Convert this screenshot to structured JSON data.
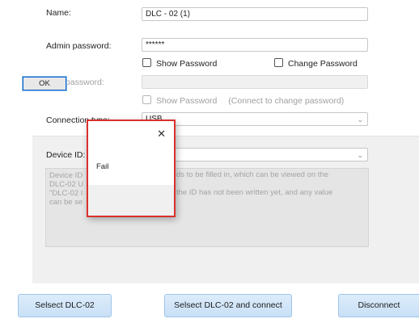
{
  "form": {
    "name_label": "Name:",
    "name_value": "DLC - 02 (1)",
    "admin_password_label": "Admin password:",
    "admin_password_value": "******",
    "show_password_1": "Show Password",
    "change_password": "Change Password",
    "new_password_label": "New password:",
    "new_password_value": "",
    "show_password_2": "Show Password",
    "change_hint": "(Connect to change password)",
    "connection_type_label": "Connection type:",
    "connection_type_value": "USB",
    "device_id_label": "Device ID:",
    "device_id_value": ""
  },
  "description": {
    "lines_left": [
      "Device ID",
      "DLC-02 U",
      "\"DLC-02 I",
      "can be se"
    ],
    "lines_right": [
      "ds to be filled in, which can be viewed on the",
      "",
      "the ID has not been written yet, and any value",
      ""
    ]
  },
  "dialog": {
    "close_glyph": "✕",
    "message": "Fail",
    "ok_label": "OK"
  },
  "buttons": {
    "select": "Selsect DLC-02",
    "select_connect": "Selsect DLC-02 and connect",
    "disconnect": "Disconnect"
  },
  "icons": {
    "dropdown": "chevron-down-icon",
    "close": "close-icon"
  },
  "colors": {
    "dialog_border": "#d9302e",
    "button_bg": "#c9e0f6"
  }
}
